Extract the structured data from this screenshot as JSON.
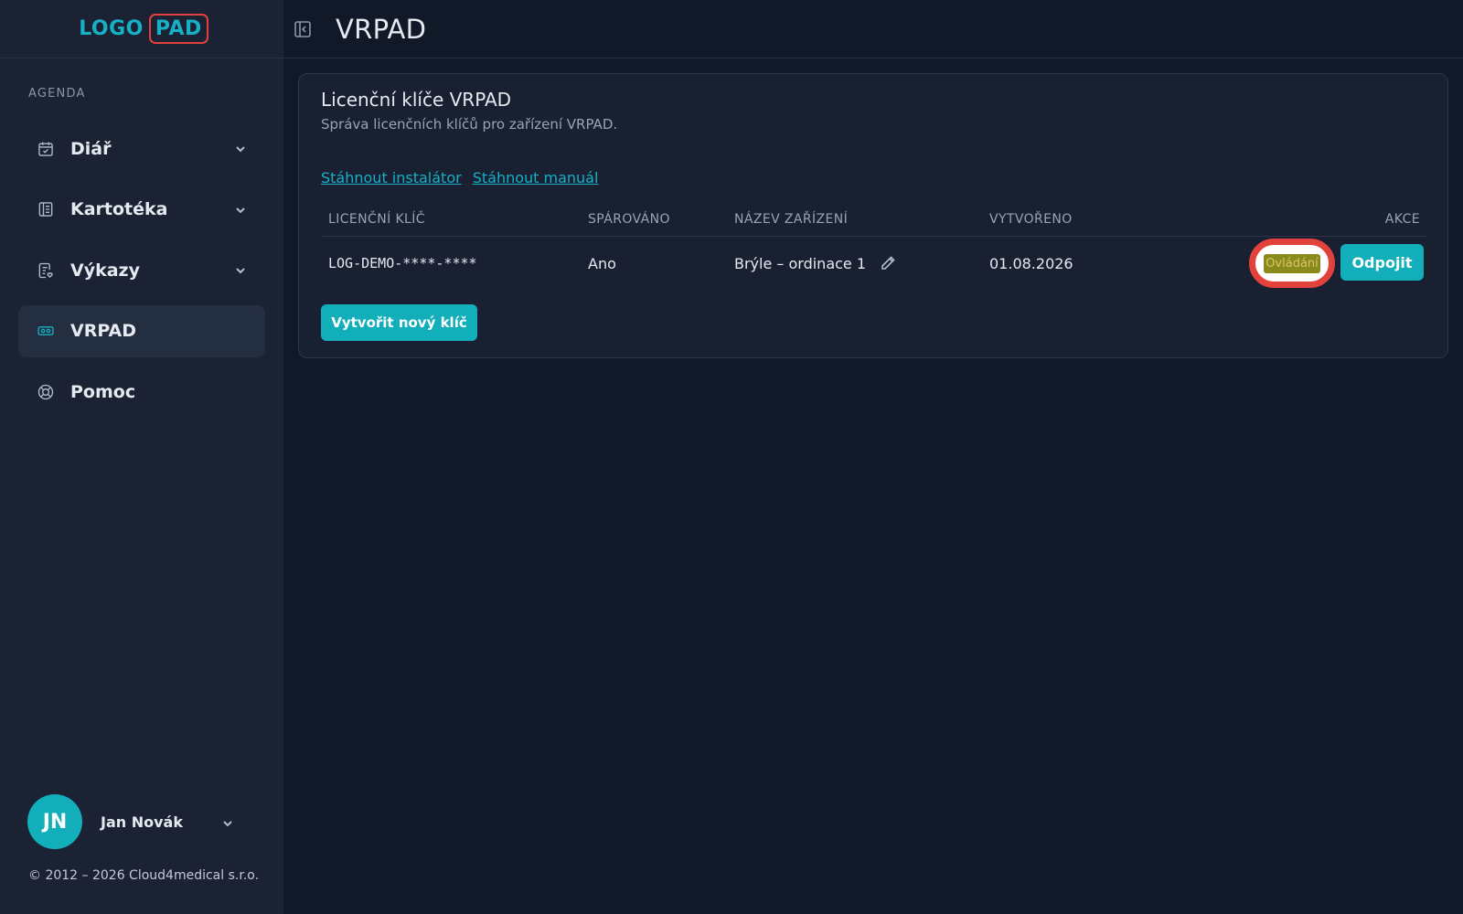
{
  "sidebar": {
    "logo": {
      "left": "LOGO",
      "right": "PAD"
    },
    "section_label": "AGENDA",
    "items": [
      {
        "label": "Diář",
        "icon": "calendar-check-icon",
        "has_chevron": true,
        "active": false
      },
      {
        "label": "Kartotéka",
        "icon": "file-cabinet-icon",
        "has_chevron": true,
        "active": false
      },
      {
        "label": "Výkazy",
        "icon": "report-icon",
        "has_chevron": true,
        "active": false
      },
      {
        "label": "VRPAD",
        "icon": "vr-headset-icon",
        "has_chevron": false,
        "active": true
      },
      {
        "label": "Pomoc",
        "icon": "lifebuoy-icon",
        "has_chevron": false,
        "active": false
      }
    ],
    "user": {
      "initials": "JN",
      "name": "Jan Novák"
    },
    "copyright": "© 2012 – 2026 Cloud4medical s.r.o."
  },
  "header": {
    "title": "VRPAD"
  },
  "card": {
    "title": "Licenční klíče VRPAD",
    "subtitle": "Správa licenčních klíčů pro zařízení VRPAD.",
    "links": {
      "installer": "Stáhnout instalátor",
      "manual": "Stáhnout manuál"
    },
    "table": {
      "headers": [
        "LICENČNÍ KLÍČ",
        "SPÁROVÁNO",
        "NÁZEV ZAŘÍZENÍ",
        "VYTVOŘENO",
        "AKCE"
      ],
      "rows": [
        {
          "key": "LOG-DEMO-****-****",
          "paired": "Ano",
          "device": "Brýle – ordinace 1",
          "created": "01.08.2026",
          "actions": {
            "control": "Ovládání",
            "disconnect": "Odpojit"
          }
        }
      ]
    },
    "create_button": "Vytvořit nový klíč"
  },
  "colors": {
    "accent": "#12aeba",
    "highlight": "#e3413b",
    "background": "#111827",
    "sidebar": "#1a2234"
  }
}
